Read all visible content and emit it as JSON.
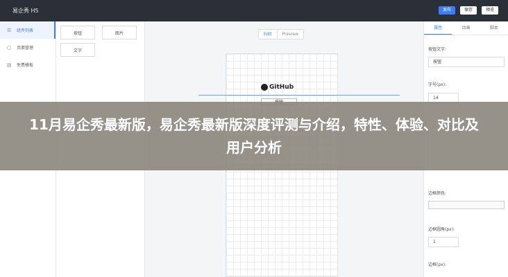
{
  "app": {
    "title": "易企秀 H5"
  },
  "topbar": {
    "actions": [
      "发布",
      "保存",
      "预览"
    ]
  },
  "sidebar": {
    "items": [
      {
        "label": "组件列表",
        "icon": "list-icon"
      },
      {
        "label": "页面管理",
        "icon": "pages-icon"
      },
      {
        "label": "免费模板",
        "icon": "template-icon"
      }
    ]
  },
  "palette": {
    "components": [
      "按钮",
      "图片",
      "文字"
    ]
  },
  "canvas": {
    "modes": [
      "Edit",
      "Preview"
    ],
    "github_text": "GitHub",
    "button_text": "按钮"
  },
  "properties": {
    "tabs": [
      "属性",
      "动画",
      "脚本"
    ],
    "button_text_label": "按钮文字:",
    "button_text_value": "按钮",
    "font_size_label": "字号(px):",
    "font_size_value": "14",
    "border_color_label": "边框颜色:",
    "border_radius_label": "边框圆角(px):",
    "border_radius_value": "1",
    "border_width_label": "边框(px):"
  },
  "overlay": {
    "headline": "11月易企秀最新版，易企秀最新版深度评测与介绍，特性、体验、对比及用户分析"
  }
}
